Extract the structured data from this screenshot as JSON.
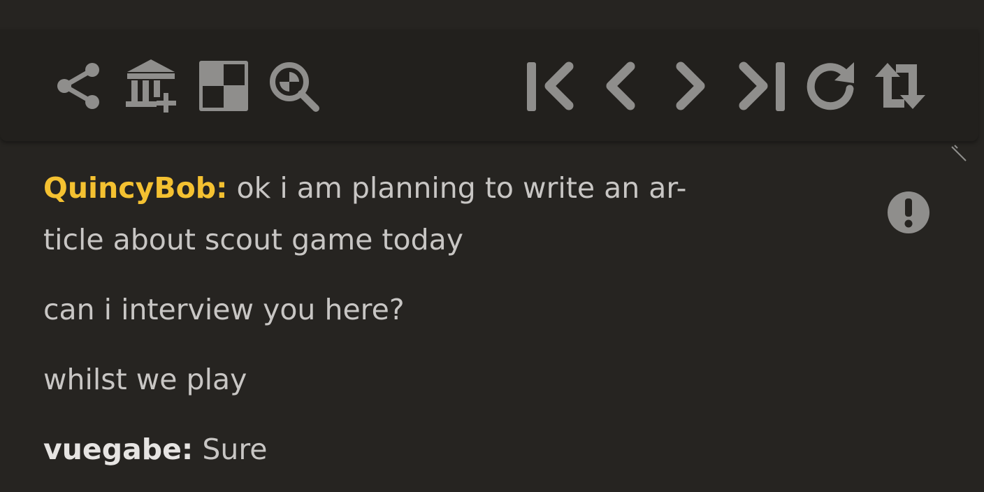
{
  "toolbar": {
    "left_icons": [
      "share-icon",
      "add-to-library-icon",
      "analysis-board-icon",
      "zoom-analysis-icon"
    ],
    "right_icons": [
      "first-move-icon",
      "previous-move-icon",
      "next-move-icon",
      "last-move-icon",
      "refresh-icon",
      "flip-board-icon"
    ]
  },
  "chat": {
    "messages": [
      {
        "user": "QuincyBob:",
        "user_color": "#f4c131",
        "text": " ok i am planning to write an ar-"
      },
      {
        "user": "",
        "text": "ticle about scout game today"
      },
      {
        "user": "",
        "text": "can i interview you here?"
      },
      {
        "user": "",
        "text": "whilst we play"
      },
      {
        "user": "vuegabe:",
        "user_color": "#e6e4e2",
        "text": " Sure"
      }
    ]
  },
  "colors": {
    "background": "#262421",
    "toolbar_bg": "#22201d",
    "icon": "#8f8e8c",
    "text": "#c8c6c4",
    "highlight_user": "#f4c131"
  }
}
